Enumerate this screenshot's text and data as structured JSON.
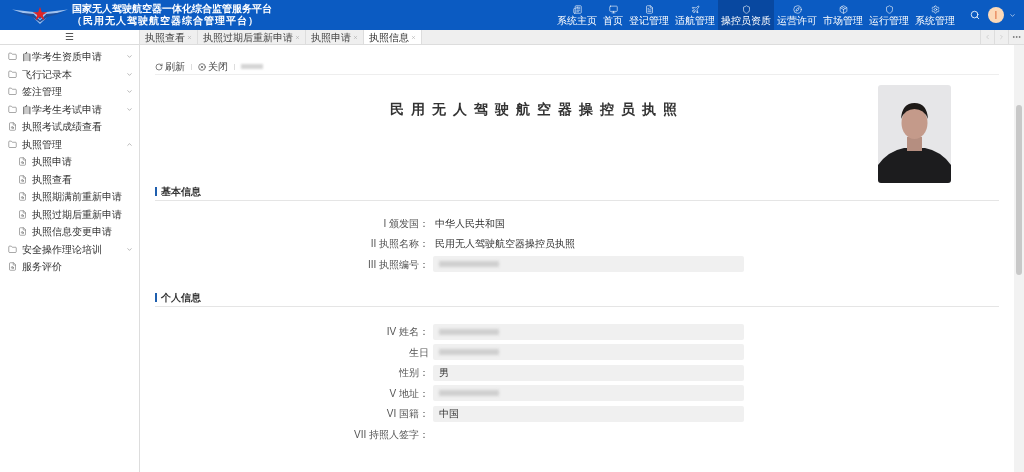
{
  "header": {
    "title": "国家无人驾驶航空器一体化综合监管服务平台",
    "subtitle": "（民用无人驾驶航空器综合管理平台）",
    "nav": [
      {
        "label": "系统主页",
        "selected": false
      },
      {
        "label": "首页",
        "selected": false
      },
      {
        "label": "登记管理",
        "selected": false
      },
      {
        "label": "适航管理",
        "selected": false
      },
      {
        "label": "操控员资质",
        "selected": true
      },
      {
        "label": "运营许可",
        "selected": false
      },
      {
        "label": "市场管理",
        "selected": false
      },
      {
        "label": "运行管理",
        "selected": false
      },
      {
        "label": "系统管理",
        "selected": false
      }
    ],
    "avatar": "I"
  },
  "menu_toggle": "☰",
  "tabs": [
    {
      "label": "执照查看",
      "selected": false
    },
    {
      "label": "执照过期后重新申请",
      "selected": false
    },
    {
      "label": "执照申请",
      "selected": false
    },
    {
      "label": "执照信息",
      "selected": true
    }
  ],
  "sidebar": [
    {
      "label": "自学考生资质申请",
      "kind": "folder",
      "expanded": false
    },
    {
      "label": "飞行记录本",
      "kind": "folder",
      "expanded": false
    },
    {
      "label": "签注管理",
      "kind": "folder",
      "expanded": false
    },
    {
      "label": "自学考生考试申请",
      "kind": "folder",
      "expanded": false
    },
    {
      "label": "执照考试成绩查看",
      "kind": "page"
    },
    {
      "label": "执照管理",
      "kind": "folder",
      "expanded": true,
      "children": [
        {
          "label": "执照申请",
          "kind": "page"
        },
        {
          "label": "执照查看",
          "kind": "page"
        },
        {
          "label": "执照期满前重新申请",
          "kind": "page"
        },
        {
          "label": "执照过期后重新申请",
          "kind": "page"
        },
        {
          "label": "执照信息变更申请",
          "kind": "page"
        }
      ]
    },
    {
      "label": "安全操作理论培训",
      "kind": "folder",
      "expanded": false
    },
    {
      "label": "服务评价",
      "kind": "page"
    }
  ],
  "toolbar": [
    {
      "label": "刷新",
      "kind": "refresh"
    },
    {
      "label": "关闭",
      "kind": "close"
    }
  ],
  "title": "民用无人驾驶航空器操控员执照",
  "sections": [
    {
      "heading": "基本信息",
      "fields": [
        {
          "label": "I 颁发国：",
          "value": "中华人民共和国",
          "boxed": false
        },
        {
          "label": "II 执照名称：",
          "value": "民用无人驾驶航空器操控员执照",
          "boxed": false
        },
        {
          "label": "III 执照编号：",
          "redacted": true,
          "boxed": true
        }
      ]
    },
    {
      "heading": "个人信息",
      "fields": [
        {
          "label": "IV 姓名：",
          "redacted": true,
          "boxed": true
        },
        {
          "label": "生日",
          "redacted": true,
          "boxed": true
        },
        {
          "label": "性别：",
          "value": "男",
          "boxed": true
        },
        {
          "label": "V 地址：",
          "redacted": true,
          "boxed": true
        },
        {
          "label": "VI 国籍：",
          "value": "中国",
          "boxed": true
        },
        {
          "label": "VII 持照人签字：",
          "boxed": false
        }
      ]
    }
  ]
}
